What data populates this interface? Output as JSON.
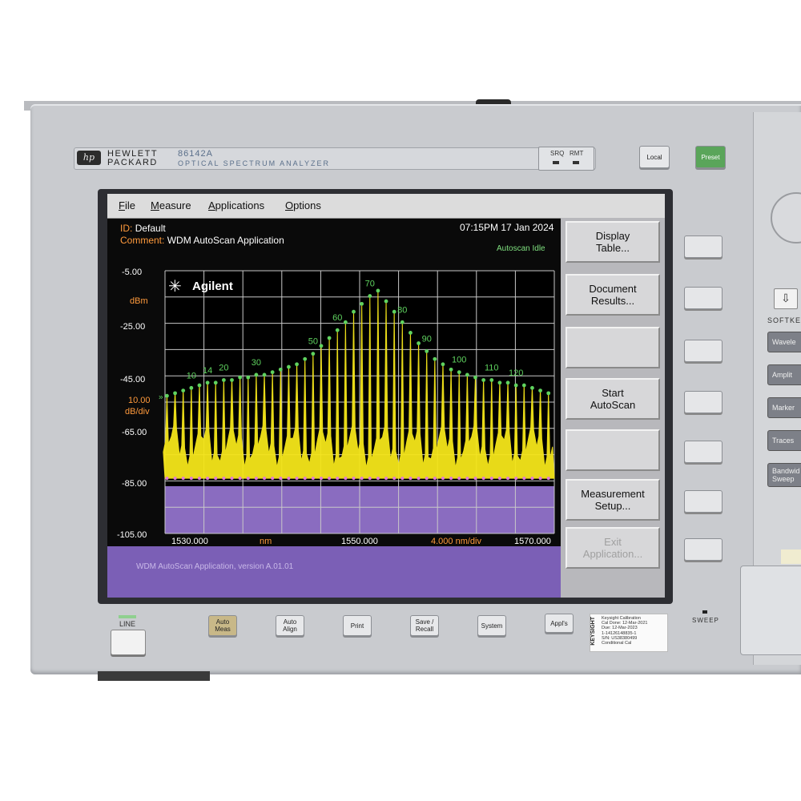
{
  "instrument": {
    "brand_line1": "HEWLETT",
    "brand_line2": "PACKARD",
    "hp_logo": "hp",
    "model": "86142A",
    "model_desc": "OPTICAL SPECTRUM ANALYZER",
    "srq_label": "SRQ",
    "rmt_label": "RMT",
    "local_label": "Local",
    "preset_label": "Preset",
    "line_label": "LINE",
    "sweep_label": "SWEEP",
    "softkeys_label": "SOFTKE",
    "bottom_buttons": [
      "Auto\nMeas",
      "Auto\nAlign",
      "Print",
      "Save /\nRecall",
      "System",
      "Appl's"
    ],
    "side_buttons": [
      "Wavele",
      "Amplit",
      "Marker",
      "Traces",
      "Bandwid\nSweep"
    ]
  },
  "calibration": {
    "vertical": "KEYSIGHT",
    "lines": [
      "Keysight Calibration",
      "Cal Done:    12-Mar-2021",
      "Due:          12-Mar-2023",
      "1-14126148835-1",
      "S/N: US38380499",
      "Conditional Cal"
    ]
  },
  "screen": {
    "menu": [
      "File",
      "Measure",
      "Applications",
      "Options"
    ],
    "id_label": "ID:",
    "id_value": "Default",
    "comment_label": "Comment:",
    "comment_value": "WDM AutoScan Application",
    "datetime": "07:15PM 17 Jan 2024",
    "status": "Autoscan Idle",
    "logo": "Agilent",
    "y_labels": [
      "-5.00",
      "-25.00",
      "-45.00",
      "-65.00",
      "-85.00",
      "-105.00"
    ],
    "y_unit": "dBm",
    "scale_value": "10.00",
    "scale_unit": "dB/div",
    "x_start": "1530.000",
    "x_unit": "nm",
    "x_center": "1550.000",
    "x_span": "4.000 nm/div",
    "x_stop": "1570.000",
    "footer": "WDM AutoScan Application, version A.01.01",
    "softkeys": [
      {
        "label": "Display\nTable...",
        "enabled": true
      },
      {
        "label": "Document\nResults...",
        "enabled": true
      },
      {
        "label": "",
        "enabled": true
      },
      {
        "label": "Start\nAutoScan",
        "enabled": true
      },
      {
        "label": "",
        "enabled": true
      },
      {
        "label": "Measurement\nSetup...",
        "enabled": true
      },
      {
        "label": "Exit\nApplication...",
        "enabled": false
      }
    ]
  },
  "chart_data": {
    "type": "line",
    "xlabel": "nm",
    "ylabel": "dBm",
    "xlim": [
      1530,
      1570
    ],
    "ylim": [
      -105,
      -5
    ],
    "grid": true,
    "channel_labels": [
      {
        "label": "10",
        "channel": 10
      },
      {
        "label": "14",
        "channel": 14
      },
      {
        "label": "20",
        "channel": 20
      },
      {
        "label": "30",
        "channel": 30
      },
      {
        "label": "50",
        "channel": 50
      },
      {
        "label": "60",
        "channel": 60
      },
      {
        "label": "70",
        "channel": 70
      },
      {
        "label": "80",
        "channel": 80
      },
      {
        "label": "90",
        "channel": 90
      },
      {
        "label": "100",
        "channel": 100
      },
      {
        "label": "110",
        "channel": 110
      },
      {
        "label": "120",
        "channel": 120
      }
    ],
    "peak_count": 48,
    "noise_floor_dbm": -84,
    "peak_envelope_dbm": [
      -52,
      -51,
      -50,
      -49,
      -48,
      -47,
      -47,
      -46,
      -46,
      -45,
      -45,
      -44,
      -44,
      -43,
      -42,
      -41,
      -40,
      -38,
      -36,
      -33,
      -30,
      -27,
      -24,
      -20,
      -17,
      -14,
      -12,
      -16,
      -20,
      -24,
      -28,
      -32,
      -35,
      -38,
      -40,
      -42,
      -43,
      -44,
      -45,
      -46,
      -46,
      -47,
      -47,
      -48,
      -48,
      -49,
      -50,
      -51
    ],
    "colors": {
      "trace": "#f5e61a",
      "peak_marker": "#5fd35f",
      "floor_marker": "#e07ad8",
      "grid": "#c8c8c8",
      "plot_bg": "#000000"
    }
  }
}
